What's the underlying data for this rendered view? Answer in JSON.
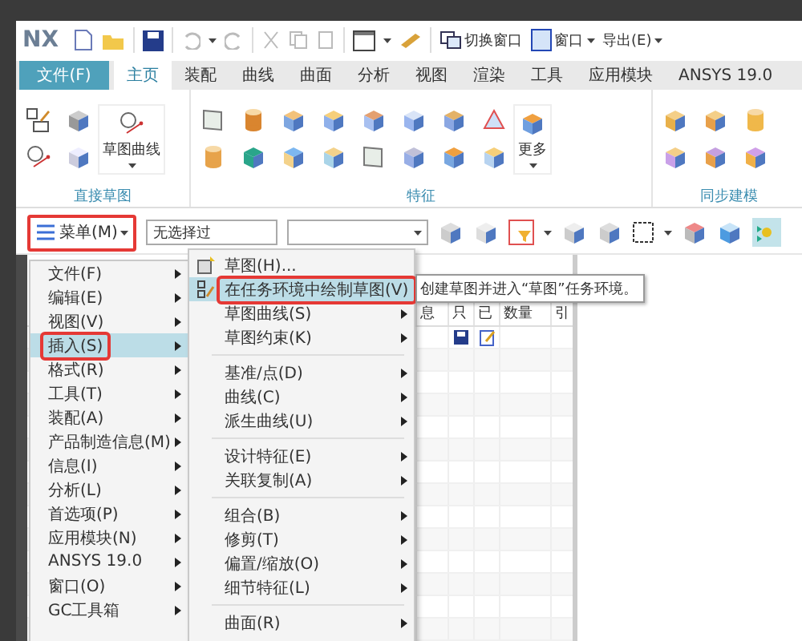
{
  "quick_access": {
    "logo": "NX",
    "buttons": [
      {
        "label": "切换窗口"
      },
      {
        "label": "窗口"
      },
      {
        "label": "导出(E)"
      }
    ]
  },
  "ribbon_tabs": [
    {
      "label": "文件(F)",
      "kind": "file",
      "selected": false
    },
    {
      "label": "主页",
      "kind": "tab",
      "selected": true
    },
    {
      "label": "装配",
      "kind": "tab",
      "selected": false
    },
    {
      "label": "曲线",
      "kind": "tab",
      "selected": false
    },
    {
      "label": "曲面",
      "kind": "tab",
      "selected": false
    },
    {
      "label": "分析",
      "kind": "tab",
      "selected": false
    },
    {
      "label": "视图",
      "kind": "tab",
      "selected": false
    },
    {
      "label": "渲染",
      "kind": "tab",
      "selected": false
    },
    {
      "label": "工具",
      "kind": "tab",
      "selected": false
    },
    {
      "label": "应用模块",
      "kind": "tab",
      "selected": false
    },
    {
      "label": "ANSYS 19.0",
      "kind": "tab",
      "selected": false
    }
  ],
  "ribbon_groups": [
    {
      "label": "直接草图",
      "big_button": "草图曲线"
    },
    {
      "label": "特征",
      "big_button": "更多"
    },
    {
      "label": "同步建模"
    }
  ],
  "toolbar": {
    "menu_button": "菜单(M)",
    "filter": "无选择过"
  },
  "main_menu": [
    {
      "label": "文件(F)",
      "selected": false
    },
    {
      "label": "编辑(E)",
      "selected": false
    },
    {
      "label": "视图(V)",
      "selected": false
    },
    {
      "label": "插入(S)",
      "selected": true
    },
    {
      "label": "格式(R)",
      "selected": false
    },
    {
      "label": "工具(T)",
      "selected": false
    },
    {
      "label": "装配(A)",
      "selected": false
    },
    {
      "label": "产品制造信息(M)",
      "selected": false
    },
    {
      "label": "信息(I)",
      "selected": false
    },
    {
      "label": "分析(L)",
      "selected": false
    },
    {
      "label": "首选项(P)",
      "selected": false
    },
    {
      "label": "应用模块(N)",
      "selected": false
    },
    {
      "label": "ANSYS 19.0",
      "selected": false
    },
    {
      "label": "窗口(O)",
      "selected": false
    },
    {
      "label": "GC工具箱",
      "selected": false
    }
  ],
  "insert_menu": [
    [
      {
        "label": "草图(H)...",
        "has_submenu": false,
        "selected": false
      },
      {
        "label": "在任务环境中绘制草图(V)",
        "has_submenu": false,
        "selected": true
      },
      {
        "label": "草图曲线(S)",
        "has_submenu": true,
        "selected": false
      },
      {
        "label": "草图约束(K)",
        "has_submenu": true,
        "selected": false
      }
    ],
    [
      {
        "label": "基准/点(D)",
        "has_submenu": true,
        "selected": false
      },
      {
        "label": "曲线(C)",
        "has_submenu": true,
        "selected": false
      },
      {
        "label": "派生曲线(U)",
        "has_submenu": true,
        "selected": false
      }
    ],
    [
      {
        "label": "设计特征(E)",
        "has_submenu": true,
        "selected": false
      },
      {
        "label": "关联复制(A)",
        "has_submenu": true,
        "selected": false
      }
    ],
    [
      {
        "label": "组合(B)",
        "has_submenu": true,
        "selected": false
      },
      {
        "label": "修剪(T)",
        "has_submenu": true,
        "selected": false
      },
      {
        "label": "偏置/缩放(O)",
        "has_submenu": true,
        "selected": false
      },
      {
        "label": "细节特征(L)",
        "has_submenu": true,
        "selected": false
      }
    ],
    [
      {
        "label": "曲面(R)",
        "has_submenu": true,
        "selected": false
      }
    ]
  ],
  "tooltip": "创建草图并进入“草图”任务环境。",
  "part_navigator": {
    "columns": [
      "息",
      "只",
      "已",
      "数量",
      "引"
    ]
  }
}
